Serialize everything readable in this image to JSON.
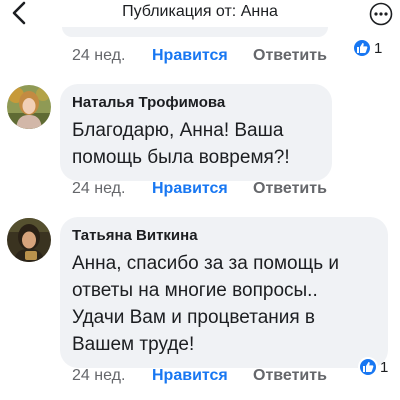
{
  "header": {
    "title": "Публикация от: Анна",
    "back_icon": "chevron-left-icon",
    "more_icon": "more-icon"
  },
  "colors": {
    "accent": "#1877f2",
    "bubble": "#f0f2f5",
    "muted": "#65676b"
  },
  "top_comment": {
    "time": "24 нед.",
    "like_label": "Нравится",
    "reply_label": "Ответить",
    "reaction_icon": "like-icon",
    "reaction_count": "1"
  },
  "comments": [
    {
      "author": "Наталья Трофимова",
      "lines": [
        "Благодарю, Анна!  Ваша",
        "помощь была вовремя?!"
      ],
      "time": "24 нед.",
      "like_label": "Нравится",
      "reply_label": "Ответить"
    },
    {
      "author": "Татьяна Виткина",
      "lines": [
        "Анна, спасибо за за помощь и",
        "ответы на многие вопросы..",
        "Удачи Вам и процветания в",
        "Вашем труде!"
      ],
      "time": "24 нед.",
      "like_label": "Нравится",
      "reply_label": "Ответить",
      "reaction_icon": "like-icon",
      "reaction_count": "1"
    }
  ]
}
